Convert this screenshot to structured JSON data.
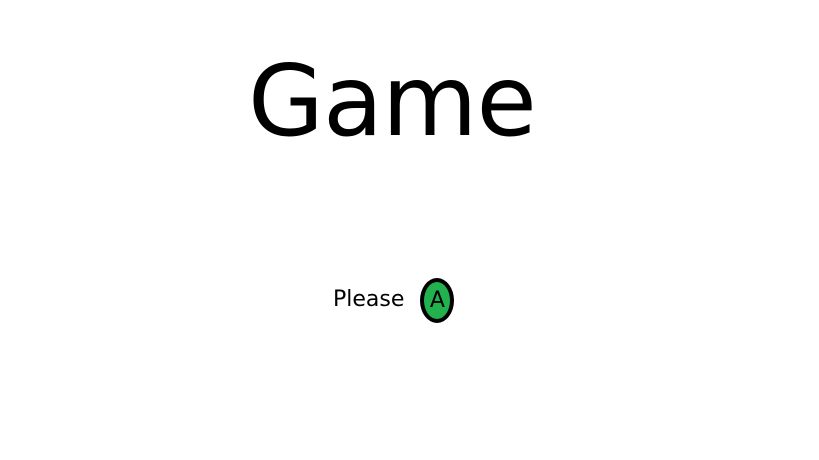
{
  "title": "Game",
  "prompt": {
    "text": "Please",
    "button_glyph": "A",
    "button_icon": "a-button-icon",
    "button_color": "#22b14c",
    "button_border_color": "#000000"
  }
}
